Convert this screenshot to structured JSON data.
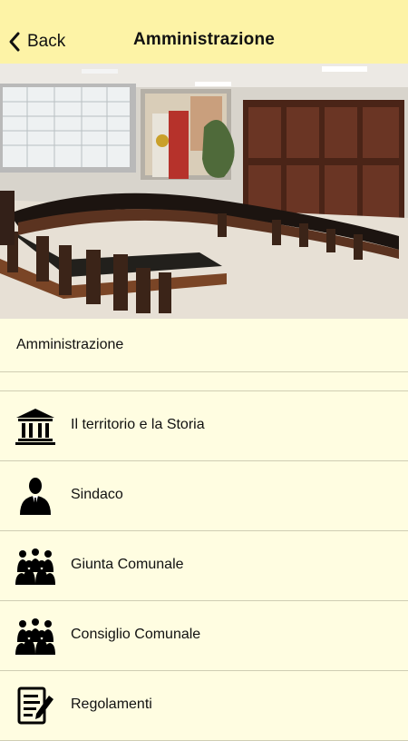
{
  "navbar": {
    "back_label": "Back",
    "title": "Amministrazione",
    "background": "#fdf3a6"
  },
  "section": {
    "header": "Amministrazione"
  },
  "menu": [
    {
      "label": "Il territorio e la Storia",
      "icon": "building-columns-icon"
    },
    {
      "label": "Sindaco",
      "icon": "person-suit-icon"
    },
    {
      "label": "Giunta Comunale",
      "icon": "group-people-icon"
    },
    {
      "label": "Consiglio Comunale",
      "icon": "group-people-icon"
    },
    {
      "label": "Regolamenti",
      "icon": "document-pen-icon"
    }
  ],
  "colors": {
    "page_background": "#fffde1",
    "separator": "#cfcdb3"
  }
}
